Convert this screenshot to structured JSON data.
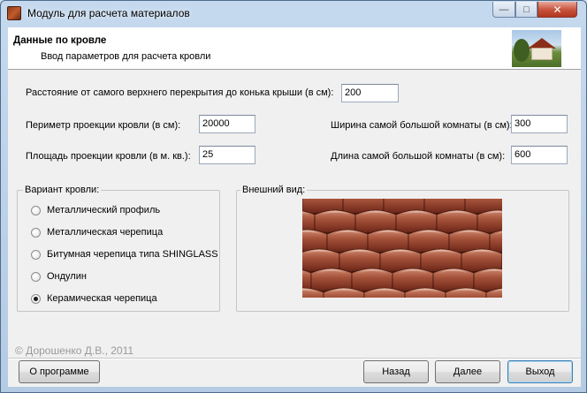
{
  "window": {
    "title": "Модуль для расчета материалов",
    "minimize_glyph": "—",
    "maximize_glyph": "□",
    "close_glyph": "✕"
  },
  "header": {
    "title": "Данные по кровле",
    "subtitle": "Ввод параметров для расчета кровли",
    "image_icon": "house-roof-photo"
  },
  "fields": {
    "ridge_distance": {
      "label": "Расстояние от самого верхнего  перекрытия до конька крыши (в см):",
      "value": "200"
    },
    "perimeter": {
      "label": "Периметр проекции кровли (в см):",
      "value": "20000"
    },
    "area": {
      "label": "Площадь проекции кровли  (в м. кв.):",
      "value": "25"
    },
    "room_width": {
      "label": "Ширина самой большой комнаты (в см):",
      "value": "300"
    },
    "room_length": {
      "label": "Длина самой большой комнаты (в см):",
      "value": "600"
    }
  },
  "roof_variant": {
    "group_label": "Вариант кровли:",
    "options": [
      {
        "label": "Металлический профиль",
        "checked": false
      },
      {
        "label": "Металлическая черепица",
        "checked": false
      },
      {
        "label": "Битумная черепица типа SHINGLASS",
        "checked": false
      },
      {
        "label": "Ондулин",
        "checked": false
      },
      {
        "label": "Керамическая черепица",
        "checked": true
      }
    ]
  },
  "appearance": {
    "group_label": "Внешний вид:",
    "image_icon": "ceramic-tile-preview"
  },
  "footer": {
    "copyright": "© Дорошенко Д.В., 2011",
    "about_label": "О программе",
    "back_label": "Назад",
    "next_label": "Далее",
    "exit_label": "Выход"
  },
  "colors": {
    "tile_base": "#7a3020",
    "tile_highlight": "#c87a62",
    "frame": "#b5cbe3",
    "close_button": "#c7513a"
  }
}
